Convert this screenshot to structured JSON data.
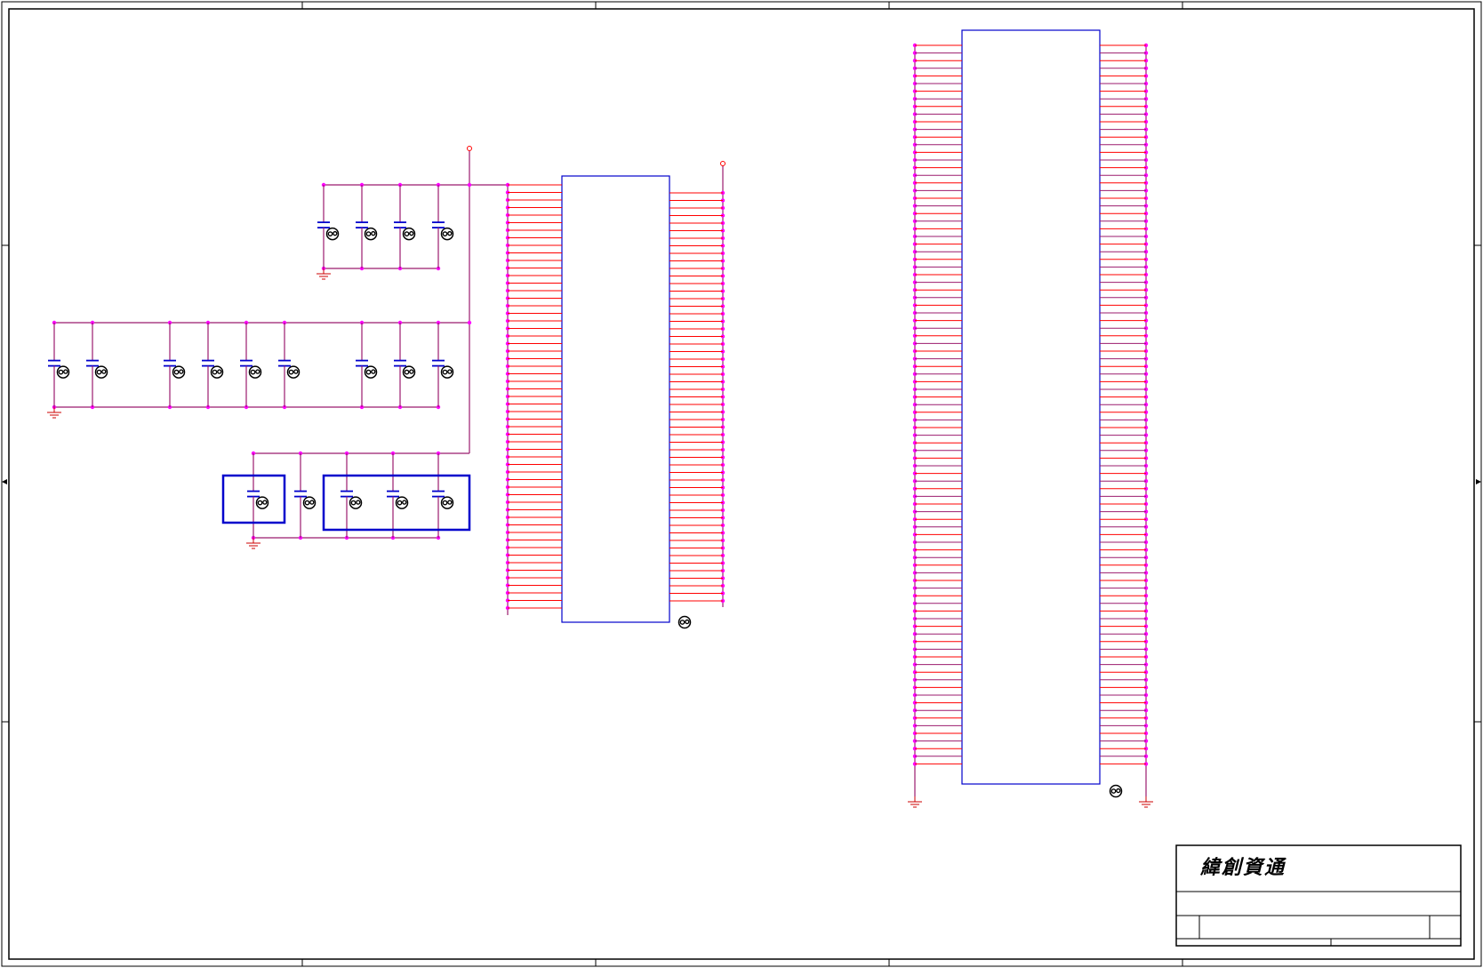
{
  "title_block": {
    "company_name": "緯創資通"
  },
  "colors": {
    "border": "#000000",
    "wire": "#9b1b6e",
    "pin": "#ff0000",
    "junction": "#ff00ff",
    "part_outline": "#0000cc",
    "capacitor": "#0000cc",
    "ground": "#cc0000"
  },
  "icons": {
    "capacitor": "capacitor-icon",
    "ground": "ground-icon",
    "power_port": "power-port-icon",
    "gp_marker": "gp-marker-icon"
  }
}
